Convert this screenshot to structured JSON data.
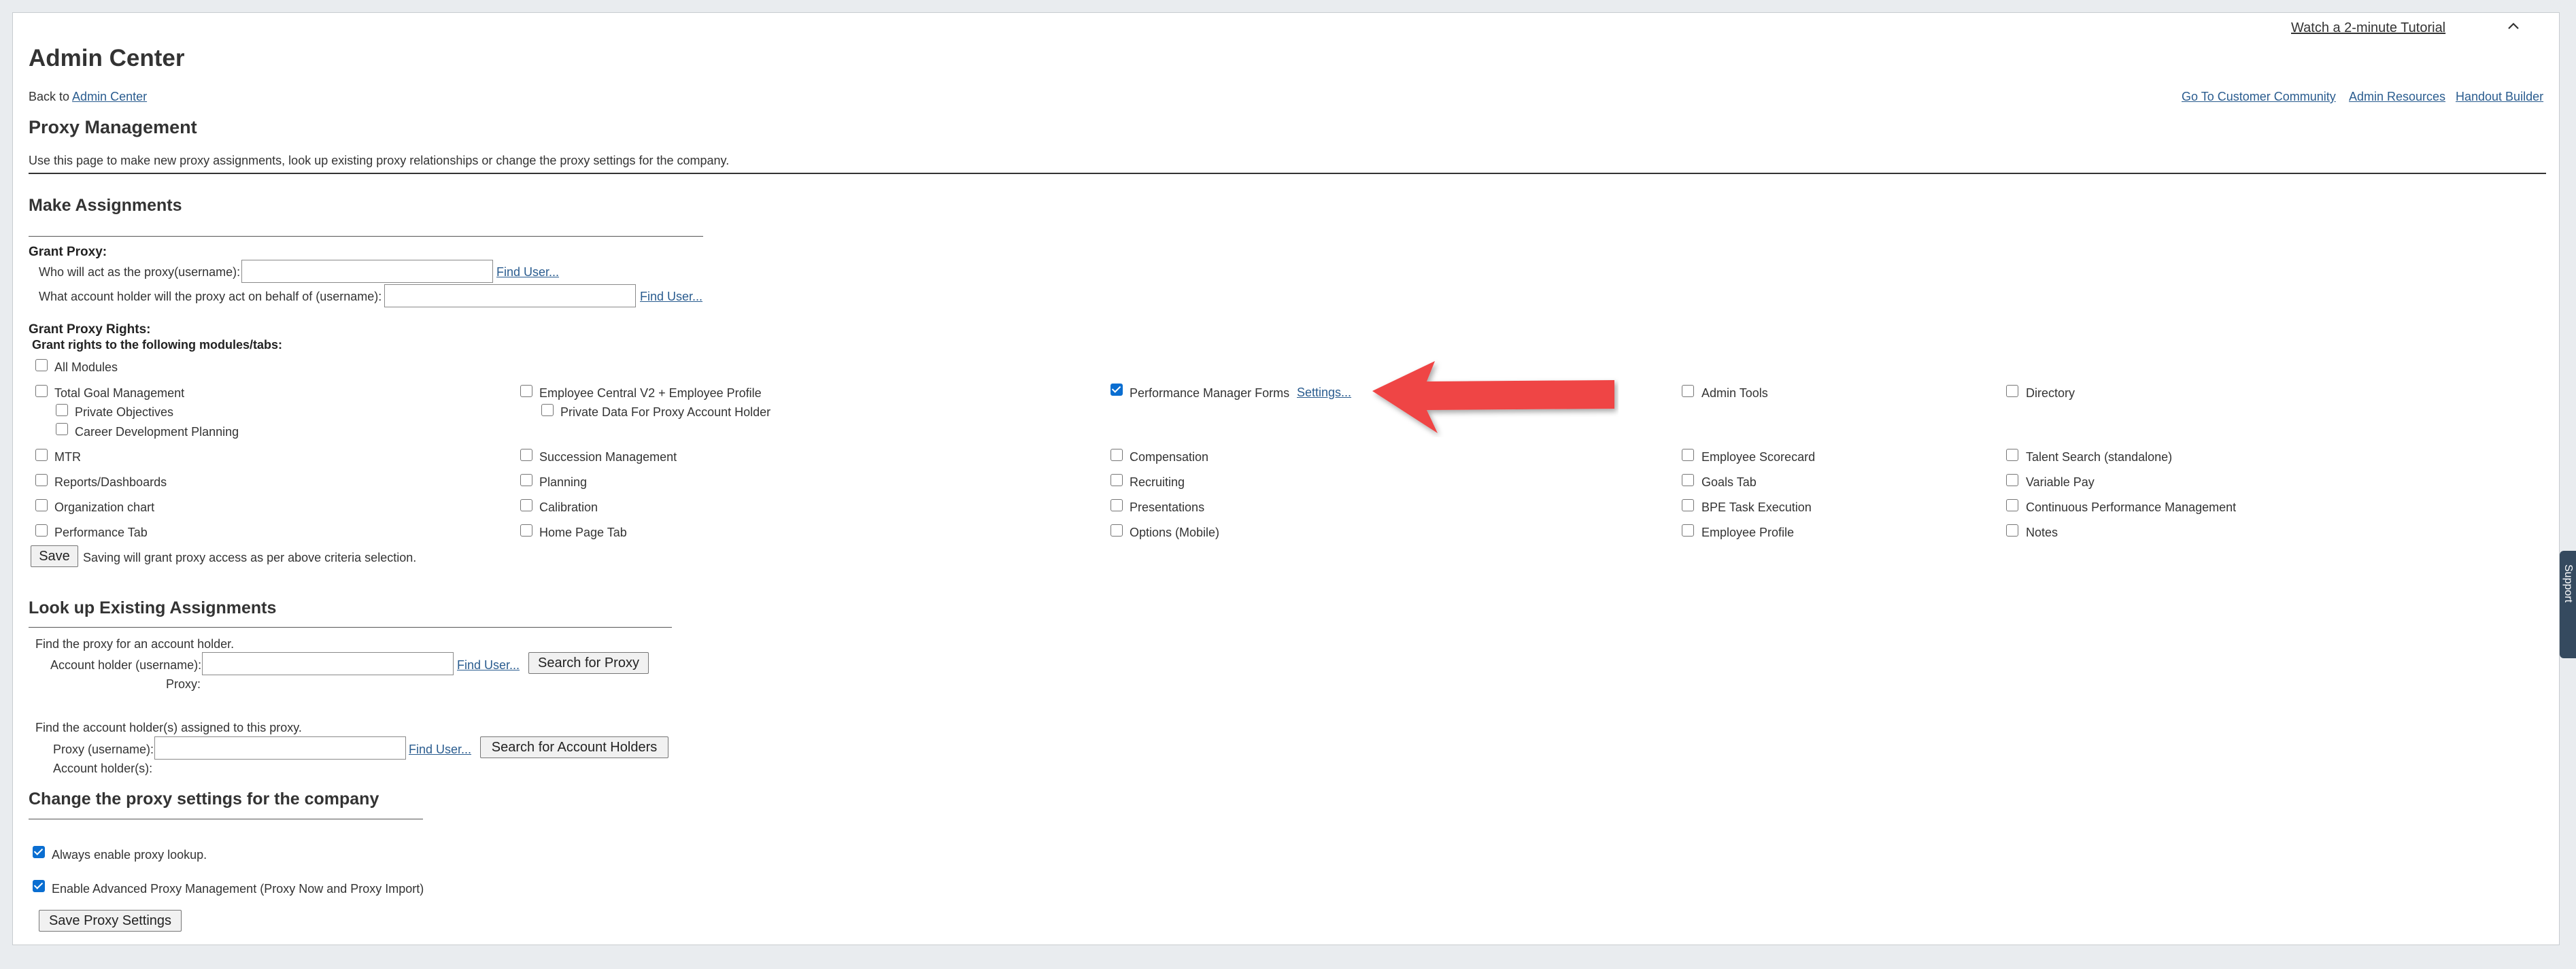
{
  "header": {
    "tutorial_link": "Watch a 2-minute Tutorial",
    "collapse_icon": "chevron-up-icon",
    "page_title": "Admin Center",
    "back_prefix": "Back to",
    "back_link": "Admin Center",
    "top_links": [
      "Go To Customer Community",
      "Admin Resources",
      "Handout Builder"
    ]
  },
  "proxy_management": {
    "title": "Proxy Management",
    "description": "Use this page to make new proxy assignments, look up existing proxy relationships or change the proxy settings for the company."
  },
  "make_assignments": {
    "title": "Make Assignments",
    "grant_proxy_label": "Grant Proxy:",
    "proxy_label": "Who will act as the proxy(username):",
    "proxy_value": "",
    "account_holder_label": "What account holder will the proxy act on behalf of (username):",
    "account_holder_value": "",
    "find_user": "Find User...",
    "grant_rights_label": "Grant Proxy Rights:",
    "grant_rights_sub": "Grant rights to the following modules/tabs:",
    "all_modules": "All Modules",
    "col1": [
      "Total Goal Management",
      "MTR",
      "Reports/Dashboards",
      "Organization chart",
      "Performance Tab"
    ],
    "col1_sub": [
      "Private Objectives",
      "Career Development Planning"
    ],
    "col2": [
      "Employee Central V2 + Employee Profile",
      "Succession Management",
      "Planning",
      "Calibration",
      "Home Page Tab"
    ],
    "col2_sub": [
      "Private Data For Proxy Account Holder"
    ],
    "col3": [
      "Performance Manager Forms",
      "Compensation",
      "Recruiting",
      "Presentations",
      "Options (Mobile)"
    ],
    "col3_settings": "Settings...",
    "col4": [
      "Admin Tools",
      "Employee Scorecard",
      "Goals Tab",
      "BPE Task Execution",
      "Employee Profile"
    ],
    "col5": [
      "Directory",
      "Talent Search (standalone)",
      "Variable Pay",
      "Continuous Performance Management",
      "Notes"
    ],
    "checked": [
      "Performance Manager Forms"
    ],
    "save_button": "Save",
    "save_note": "Saving will grant proxy access as per above criteria selection."
  },
  "lookup": {
    "title": "Look up Existing Assignments",
    "find_proxy_desc": "Find the proxy for an account holder.",
    "account_holder_label": "Account holder (username):",
    "account_holder_value": "",
    "search_proxy_button": "Search for Proxy",
    "proxy_result_label": "Proxy:",
    "find_holders_desc": "Find the account holder(s) assigned to this proxy.",
    "proxy_label": "Proxy (username):",
    "proxy_value": "",
    "search_holders_button": "Search for Account Holders",
    "holders_result_label": "Account holder(s):",
    "find_user": "Find User..."
  },
  "company_settings": {
    "title": "Change the proxy settings for the company",
    "always_enable": "Always enable proxy lookup.",
    "always_enable_checked": true,
    "advanced": "Enable Advanced Proxy Management (Proxy Now and Proxy Import)",
    "advanced_checked": true,
    "save_button": "Save Proxy Settings"
  },
  "annotation": {
    "arrow_color": "#ef4444"
  },
  "support_tab": "Support"
}
